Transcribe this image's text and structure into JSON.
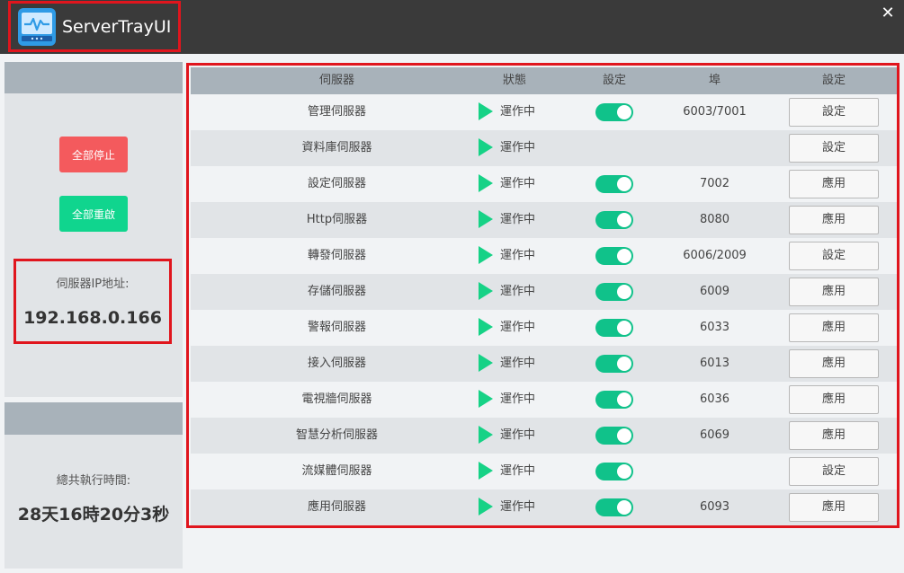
{
  "app": {
    "title": "ServerTrayUI",
    "close_label": "✕"
  },
  "sidebar": {
    "stop_all": "全部停止",
    "restart_all": "全部重啟",
    "ip_label": "伺服器IP地址:",
    "ip_value": "192.168.0.166",
    "uptime_label": "總共執行時間:",
    "uptime_value": "28天16時20分3秒"
  },
  "table": {
    "headers": [
      "伺服器",
      "狀態",
      "設定",
      "埠",
      "設定"
    ],
    "rows": [
      {
        "name": "管理伺服器",
        "status": "運作中",
        "toggle": true,
        "port": "6003/7001",
        "action": "設定"
      },
      {
        "name": "資料庫伺服器",
        "status": "運作中",
        "toggle": false,
        "port": "",
        "action": "設定"
      },
      {
        "name": "設定伺服器",
        "status": "運作中",
        "toggle": true,
        "port": "7002",
        "action": "應用"
      },
      {
        "name": "Http伺服器",
        "status": "運作中",
        "toggle": true,
        "port": "8080",
        "action": "應用"
      },
      {
        "name": "轉發伺服器",
        "status": "運作中",
        "toggle": true,
        "port": "6006/2009",
        "action": "設定"
      },
      {
        "name": "存儲伺服器",
        "status": "運作中",
        "toggle": true,
        "port": "6009",
        "action": "應用"
      },
      {
        "name": "警報伺服器",
        "status": "運作中",
        "toggle": true,
        "port": "6033",
        "action": "應用"
      },
      {
        "name": "接入伺服器",
        "status": "運作中",
        "toggle": true,
        "port": "6013",
        "action": "應用"
      },
      {
        "name": "電視牆伺服器",
        "status": "運作中",
        "toggle": true,
        "port": "6036",
        "action": "應用"
      },
      {
        "name": "智慧分析伺服器",
        "status": "運作中",
        "toggle": true,
        "port": "6069",
        "action": "應用"
      },
      {
        "name": "流媒體伺服器",
        "status": "運作中",
        "toggle": true,
        "port": "",
        "action": "設定"
      },
      {
        "name": "應用伺服器",
        "status": "運作中",
        "toggle": true,
        "port": "6093",
        "action": "應用"
      }
    ]
  },
  "colors": {
    "accent_green": "#10c28a",
    "stop_red": "#f45a5d",
    "highlight_red": "#e0151d"
  },
  "icons": {
    "logo": "monitor-pulse-icon",
    "close": "close-icon",
    "status": "play-icon"
  }
}
